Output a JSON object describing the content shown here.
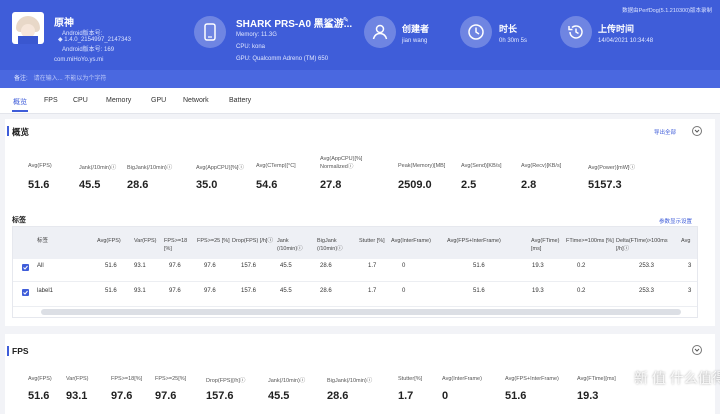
{
  "header": {
    "app_name": "原神",
    "app_lines": [
      "Android版本号:",
      "◆ 1.4.0_2154997_2147343",
      "Android版本号: 169"
    ],
    "package": "com.miHoYo.ys.mi",
    "device_name": "SHARK PRS-A0 黑鲨游...",
    "device_memory": "Memory: 11.3G",
    "device_cpu": "CPU: kona",
    "device_gpu": "GPU: Qualcomm Adreno (TM) 650",
    "creator_title": "创建者",
    "creator_value": "jian wang",
    "duration_title": "时长",
    "duration_value": "0h 30m 5s",
    "upload_title": "上传时间",
    "upload_value": "14/04/2021 10:34:48",
    "version": "数据由PerfDog(5.1.210300)版本录制"
  },
  "notebar": {
    "label": "备注:",
    "text": "请在输入... 不能以为个字符"
  },
  "tabs": [
    "概览",
    "FPS",
    "CPU",
    "Memory",
    "GPU",
    "Network",
    "Battery"
  ],
  "overview": {
    "title": "概览",
    "export_link": "导出全部",
    "metrics": [
      {
        "label": "Avg(FPS)",
        "value": "51.6"
      },
      {
        "label": "Jank(/10min)ⓘ",
        "value": "45.5"
      },
      {
        "label": "BigJank(/10min)ⓘ",
        "value": "28.6"
      },
      {
        "label": "Avg(AppCPU)[%]ⓘ",
        "value": "35.0"
      },
      {
        "label": "Avg(CTemp)[°C]",
        "value": "54.6"
      },
      {
        "label": "Avg(AppCPU)[%] Normalizedⓘ",
        "value": "27.8"
      },
      {
        "label": "Peak(Memory)[MB]",
        "value": "2509.0"
      },
      {
        "label": "Avg(Send)[KB/s]",
        "value": "2.5"
      },
      {
        "label": "Avg(Recv)[KB/s]",
        "value": "2.8"
      },
      {
        "label": "Avg(Power)[mW]ⓘ",
        "value": "5157.3"
      }
    ]
  },
  "labels": {
    "title": "标签",
    "settings_link": "参数显示设置",
    "columns": [
      "标签",
      "Avg(FPS)",
      "Var(FPS)",
      "FPS>=18 [%]",
      "FPS>=25 [%]",
      "Drop(FPS) [/h]ⓘ",
      "Jank (/10min)ⓘ",
      "BigJank (/10min)ⓘ",
      "Stutter [%]",
      "Avg(InterFrame)",
      "Avg(FPS+InterFrame)",
      "Avg(FTime) [ms]",
      "FTime>=100ms [%]",
      "Delta(FTime)>100ms [/h]ⓘ",
      "Avg"
    ],
    "rows": [
      {
        "name": "All",
        "cells": [
          "51.6",
          "93.1",
          "97.6",
          "97.6",
          "157.6",
          "45.5",
          "28.6",
          "1.7",
          "0",
          "51.6",
          "19.3",
          "0.2",
          "253.3",
          "3"
        ]
      },
      {
        "name": "label1",
        "cells": [
          "51.6",
          "93.1",
          "97.6",
          "97.6",
          "157.6",
          "45.5",
          "28.6",
          "1.7",
          "0",
          "51.6",
          "19.3",
          "0.2",
          "253.3",
          "3"
        ]
      }
    ]
  },
  "fps": {
    "title": "FPS",
    "metrics": [
      {
        "label": "Avg(FPS)",
        "value": "51.6"
      },
      {
        "label": "Var(FPS)",
        "value": "93.1"
      },
      {
        "label": "FPS>=18[%]",
        "value": "97.6"
      },
      {
        "label": "FPS>=25[%]",
        "value": "97.6"
      },
      {
        "label": "Drop(FPS)[/h]ⓘ",
        "value": "157.6"
      },
      {
        "label": "Jank(/10min)ⓘ",
        "value": "45.5"
      },
      {
        "label": "BigJank(/10min)ⓘ",
        "value": "28.6"
      },
      {
        "label": "Stutter[%]",
        "value": "1.7"
      },
      {
        "label": "Avg(InterFrame)",
        "value": "0"
      },
      {
        "label": "Avg(FPS+InterFrame)",
        "value": "51.6"
      },
      {
        "label": "Avg(FTime)[ms]",
        "value": "19.3"
      }
    ]
  },
  "watermark": "新 值 什么值得买",
  "colors": {
    "accent": "#3f5dd9",
    "header_bg": "#3f5dd9"
  }
}
